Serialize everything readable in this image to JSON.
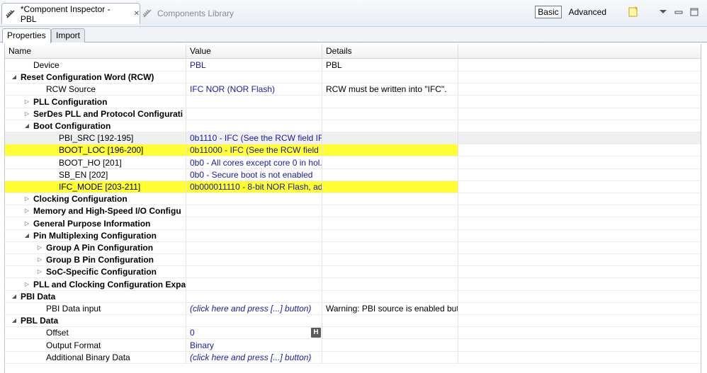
{
  "tabs": {
    "active_title": "*Component Inspector - PBL",
    "inactive_title": "Components Library"
  },
  "toolbar": {
    "basic_label": "Basic",
    "advanced_label": "Advanced"
  },
  "subtabs": {
    "properties": "Properties",
    "import": "Import"
  },
  "columns": {
    "name": "Name",
    "value": "Value",
    "details": "Details"
  },
  "colors": {
    "highlight": "#ffff33",
    "value_text": "#1a1aa6"
  },
  "rows": [
    {
      "name": "Device",
      "value": "PBL",
      "details": "PBL",
      "indent": 2,
      "toggle": "",
      "bold": false
    },
    {
      "name": "Reset Configuration Word (RCW)",
      "value": "",
      "details": "",
      "indent": 1,
      "toggle": "expanded",
      "bold": true
    },
    {
      "name": "RCW Source",
      "value": "IFC NOR (NOR Flash)",
      "details": "RCW must be written into  \"IFC\".",
      "indent": 3,
      "toggle": "",
      "bold": false
    },
    {
      "name": "PLL Configuration",
      "value": "",
      "details": "",
      "indent": 2,
      "toggle": "collapsed",
      "bold": true
    },
    {
      "name": "SerDes PLL and Protocol Configurati",
      "value": "",
      "details": "",
      "indent": 2,
      "toggle": "collapsed",
      "bold": true
    },
    {
      "name": "Boot Configuration",
      "value": "",
      "details": "",
      "indent": 2,
      "toggle": "expanded",
      "bold": true
    },
    {
      "name": "PBI_SRC  [192-195]",
      "value": "0b1110 - IFC (See the RCW field IF...",
      "details": "",
      "indent": 4,
      "toggle": "",
      "bold": false,
      "selected": true
    },
    {
      "name": "BOOT_LOC  [196-200]",
      "value": "0b11000 - IFC (See the RCW field IF...",
      "details": "",
      "indent": 4,
      "toggle": "",
      "bold": false,
      "highlight": true
    },
    {
      "name": "BOOT_HO  [201]",
      "value": "0b0 - All cores except core 0 in hol...",
      "details": "",
      "indent": 4,
      "toggle": "",
      "bold": false
    },
    {
      "name": "SB_EN  [202]",
      "value": "0b0 - Secure boot is not enabled",
      "details": "",
      "indent": 4,
      "toggle": "",
      "bold": false
    },
    {
      "name": "IFC_MODE  [203-211]",
      "value": "0b000011110 - 8-bit NOR Flash, ad...",
      "details": "",
      "indent": 4,
      "toggle": "",
      "bold": false,
      "highlight": true
    },
    {
      "name": "Clocking Configuration",
      "value": "",
      "details": "",
      "indent": 2,
      "toggle": "collapsed",
      "bold": true
    },
    {
      "name": "Memory and High-Speed I/O Configu",
      "value": "",
      "details": "",
      "indent": 2,
      "toggle": "collapsed",
      "bold": true
    },
    {
      "name": "General Purpose Information",
      "value": "",
      "details": "",
      "indent": 2,
      "toggle": "collapsed",
      "bold": true
    },
    {
      "name": "Pin Multiplexing Configuration",
      "value": "",
      "details": "",
      "indent": 2,
      "toggle": "expanded",
      "bold": true
    },
    {
      "name": "Group A Pin Configuration",
      "value": "",
      "details": "",
      "indent": 3,
      "toggle": "collapsed",
      "bold": true
    },
    {
      "name": "Group B Pin Configuration",
      "value": "",
      "details": "",
      "indent": 3,
      "toggle": "collapsed",
      "bold": true
    },
    {
      "name": "SoC-Specific Configuration",
      "value": "",
      "details": "",
      "indent": 3,
      "toggle": "collapsed",
      "bold": true
    },
    {
      "name": "PLL and Clocking Configuration Expa",
      "value": "",
      "details": "",
      "indent": 2,
      "toggle": "collapsed",
      "bold": true
    },
    {
      "name": "PBI Data",
      "value": "",
      "details": "",
      "indent": 1,
      "toggle": "expanded",
      "bold": true
    },
    {
      "name": "PBI Data input",
      "value": "(click here and press [...] button)",
      "details": "Warning: PBI source is enabled but...",
      "indent": 3,
      "toggle": "",
      "bold": false,
      "italic_value": true
    },
    {
      "name": "PBL Data",
      "value": "",
      "details": "",
      "indent": 1,
      "toggle": "expanded",
      "bold": true
    },
    {
      "name": "Offset",
      "value": "0",
      "details": "",
      "indent": 3,
      "toggle": "",
      "bold": false,
      "hbutton": "H"
    },
    {
      "name": "Output Format",
      "value": "Binary",
      "details": "",
      "indent": 3,
      "toggle": "",
      "bold": false
    },
    {
      "name": "Additional Binary Data",
      "value": "(click here and press [...] button)",
      "details": "",
      "indent": 3,
      "toggle": "",
      "bold": false,
      "italic_value": true
    }
  ]
}
